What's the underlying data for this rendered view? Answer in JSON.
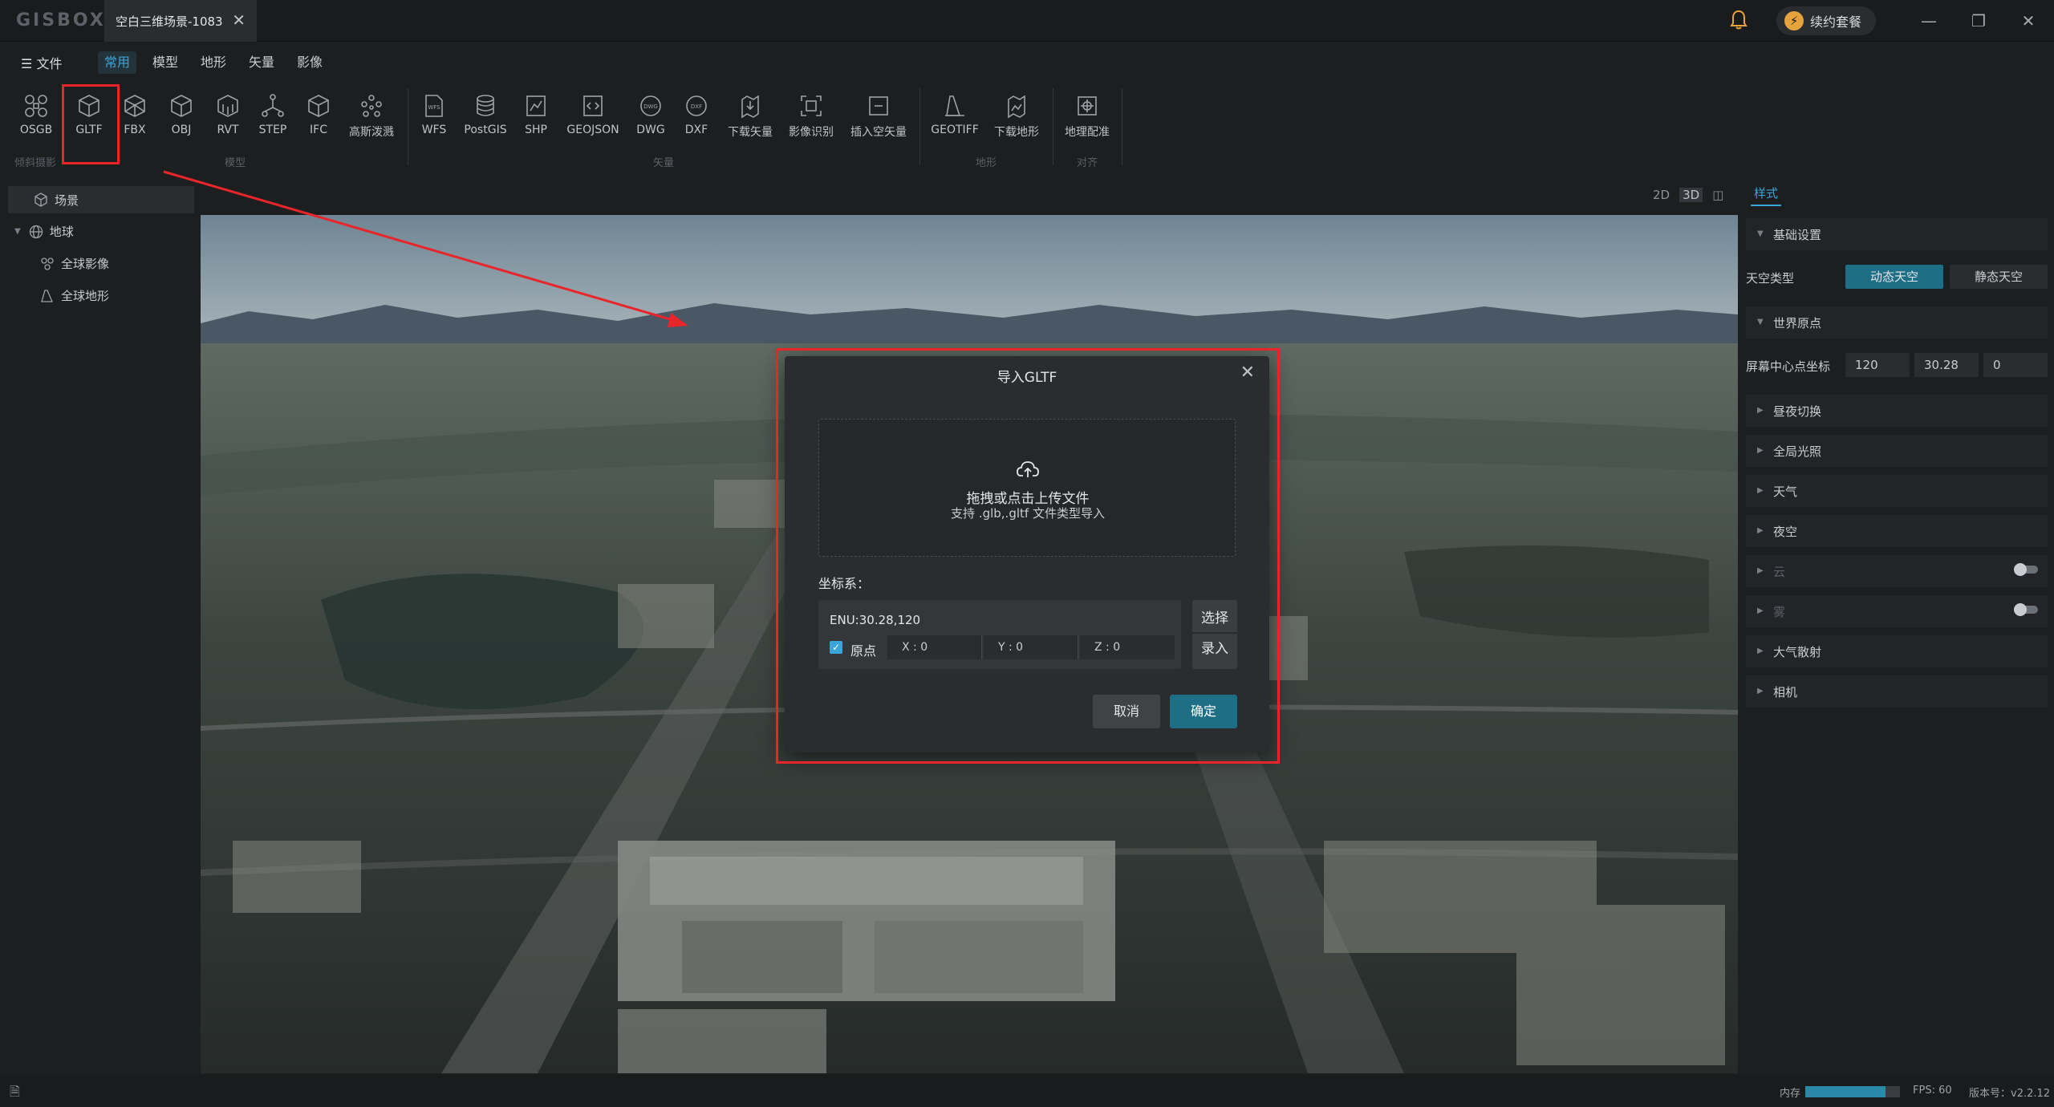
{
  "titlebar": {
    "logo": "GISBOX",
    "doc_tab": "空白三维场景-1083",
    "renew_label": "续约套餐"
  },
  "menubar": {
    "file": "文件",
    "tabs": [
      "常用",
      "模型",
      "地形",
      "矢量",
      "影像"
    ],
    "active_tab": "常用"
  },
  "ribbon": {
    "tools": [
      "OSGB",
      "GLTF",
      "FBX",
      "OBJ",
      "RVT",
      "STEP",
      "IFC",
      "高斯泼溅",
      "WFS",
      "PostGIS",
      "SHP",
      "GEOJSON",
      "DWG",
      "DXF",
      "下载矢量",
      "影像识别",
      "插入空矢量",
      "GEOTIFF",
      "下载地形",
      "地理配准"
    ],
    "groups": [
      "倾斜摄影",
      "模型",
      "矢量",
      "地形",
      "对齐"
    ],
    "selected_tool": "GLTF"
  },
  "scene_tree": {
    "root": "场景",
    "globe": "地球",
    "imagery": "全球影像",
    "terrain": "全球地形"
  },
  "view_modes": [
    "2D",
    "3D"
  ],
  "right_panel": {
    "tab": "样式",
    "basic_settings": "基础设置",
    "sky_type_label": "天空类型",
    "sky_options": [
      "动态天空",
      "静态天空"
    ],
    "sky_selected": "动态天空",
    "world_origin": "世界原点",
    "screen_center_label": "屏幕中心点坐标",
    "screen_center": [
      "120",
      "30.28",
      "0"
    ],
    "sections": [
      "昼夜切换",
      "全局光照",
      "天气",
      "夜空",
      "云",
      "雾",
      "大气散射",
      "相机"
    ],
    "disabled_sections": [
      "云",
      "雾"
    ]
  },
  "status": {
    "memory_label": "内存",
    "memory_fraction": 0.85,
    "fps": "FPS: 60",
    "version": "版本号：v2.2.12"
  },
  "dialog": {
    "title": "导入GLTF",
    "drop_title": "拖拽或点击上传文件",
    "drop_sub": "支持 .glb,.gltf 文件类型导入",
    "coord_label": "坐标系：",
    "coord_value": "ENU:30.28,120",
    "origin_label": "原点",
    "origin_checked": true,
    "x": "X : 0",
    "y": "Y : 0",
    "z": "Z : 0",
    "pick": "选择",
    "enter": "录入",
    "cancel": "取消",
    "ok": "确定"
  },
  "colors": {
    "accent": "#3aa5d8",
    "primary_button": "#1e6f86",
    "highlight": "#e8262a"
  }
}
